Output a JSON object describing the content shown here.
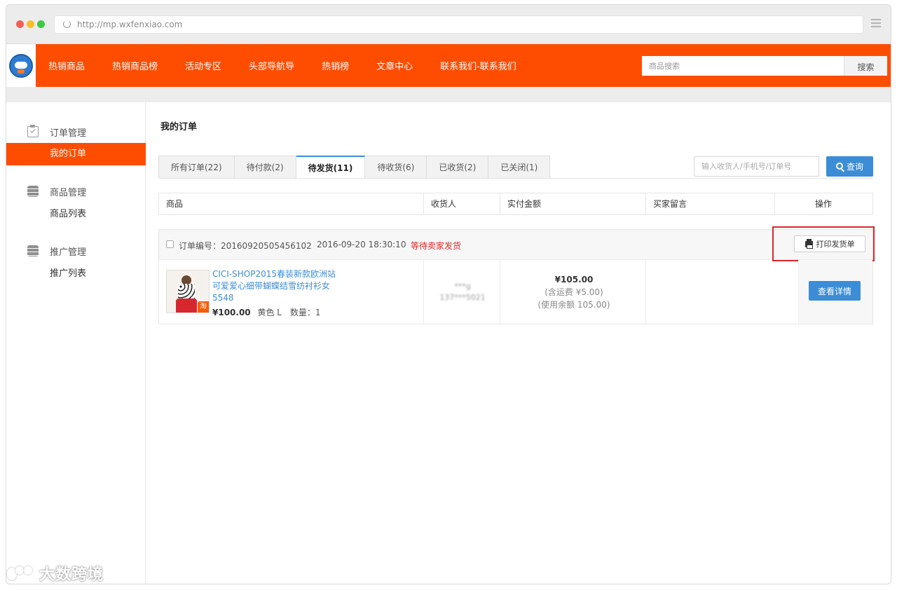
{
  "browser": {
    "url": "http://mp.wxfenxiao.com"
  },
  "top_nav": {
    "items": [
      "热销商品",
      "热销商品榜",
      "活动专区",
      "头部导航导",
      "热销榜",
      "文章中心",
      "联系我们-联系我们"
    ],
    "search_placeholder": "商品搜索",
    "search_button": "搜索"
  },
  "sidebar": {
    "groups": [
      {
        "title": "订单管理",
        "items": [
          "我的订单"
        ]
      },
      {
        "title": "商品管理",
        "items": [
          "商品列表"
        ]
      },
      {
        "title": "推广管理",
        "items": [
          "推广列表"
        ]
      }
    ],
    "active_item": "我的订单"
  },
  "main": {
    "title": "我的订单",
    "tabs": [
      {
        "label": "所有订单(22)"
      },
      {
        "label": "待付款(2)"
      },
      {
        "label": "待发货(11)",
        "active": true
      },
      {
        "label": "待收货(6)"
      },
      {
        "label": "已收货(2)"
      },
      {
        "label": "已关闭(1)"
      }
    ],
    "query_placeholder": "输入收货人/手机号/订单号",
    "query_button": "查询",
    "table_headers": [
      "商品",
      "收货人",
      "实付金额",
      "买家留言",
      "操作"
    ],
    "order": {
      "number_label": "订单编号：20160920505456102",
      "datetime": "2016-09-20 18:30:10",
      "status": "等待卖家发货",
      "print_button": "打印发货单",
      "product_name": "CICI-SHOP2015春装新款欧洲站可爱爱心细带蝴蝶结雪纺衬衫女5548",
      "price": "¥100.00",
      "spec": "黄色 L",
      "quantity": "数量：1",
      "receiver_line1": "***g",
      "receiver_line2": "137***5021",
      "amount_main": "¥105.00",
      "amount_shipping": "(含运费 ¥5.00)",
      "amount_balance": "(使用余额 105.00)",
      "detail_button": "查看详情"
    }
  },
  "watermark": {
    "text": "大数跨境"
  }
}
